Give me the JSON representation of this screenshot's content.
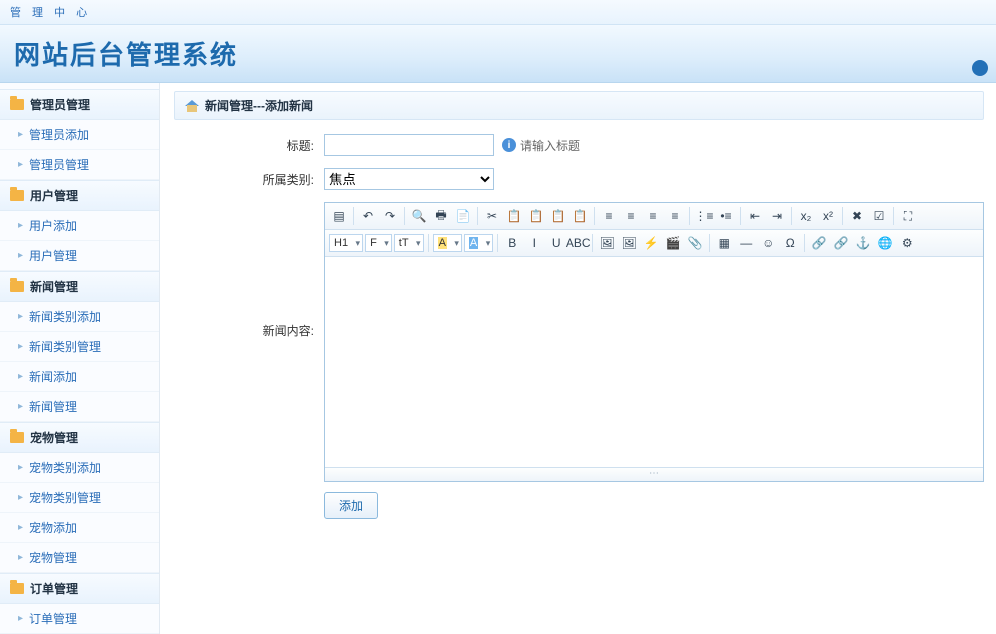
{
  "header": {
    "top_label": "管 理 中 心",
    "title": "网站后台管理系统"
  },
  "sidebar": {
    "groups": [
      {
        "label": "管理员管理",
        "items": [
          "管理员添加",
          "管理员管理"
        ]
      },
      {
        "label": "用户管理",
        "items": [
          "用户添加",
          "用户管理"
        ]
      },
      {
        "label": "新闻管理",
        "items": [
          "新闻类别添加",
          "新闻类别管理",
          "新闻添加",
          "新闻管理"
        ]
      },
      {
        "label": "宠物管理",
        "items": [
          "宠物类别添加",
          "宠物类别管理",
          "宠物添加",
          "宠物管理"
        ]
      },
      {
        "label": "订单管理",
        "items": [
          "订单管理"
        ]
      }
    ]
  },
  "breadcrumb": "新闻管理---添加新闻",
  "form": {
    "title_label": "标题:",
    "title_hint": "请输入标题",
    "category_label": "所属类别:",
    "category_value": "焦点",
    "content_label": "新闻内容:",
    "submit_label": "添加"
  },
  "editor": {
    "row1": [
      {
        "t": "btn",
        "n": "source",
        "g": "▤"
      },
      {
        "t": "sep"
      },
      {
        "t": "btn",
        "n": "undo",
        "g": "↶"
      },
      {
        "t": "btn",
        "n": "redo",
        "g": "↷"
      },
      {
        "t": "sep"
      },
      {
        "t": "btn",
        "n": "preview",
        "g": "🔍"
      },
      {
        "t": "btn",
        "n": "print",
        "g": "🖶"
      },
      {
        "t": "btn",
        "n": "template",
        "g": "📄"
      },
      {
        "t": "sep"
      },
      {
        "t": "btn",
        "n": "cut",
        "g": "✂"
      },
      {
        "t": "btn",
        "n": "copy",
        "g": "📋"
      },
      {
        "t": "btn",
        "n": "paste",
        "g": "📋"
      },
      {
        "t": "btn",
        "n": "paste-text",
        "g": "📋"
      },
      {
        "t": "btn",
        "n": "paste-word",
        "g": "📋"
      },
      {
        "t": "sep"
      },
      {
        "t": "btn",
        "n": "align-left",
        "g": "≡"
      },
      {
        "t": "btn",
        "n": "align-center",
        "g": "≡"
      },
      {
        "t": "btn",
        "n": "align-right",
        "g": "≡"
      },
      {
        "t": "btn",
        "n": "align-justify",
        "g": "≡"
      },
      {
        "t": "sep"
      },
      {
        "t": "btn",
        "n": "list-ol",
        "g": "⋮≡"
      },
      {
        "t": "btn",
        "n": "list-ul",
        "g": "•≡"
      },
      {
        "t": "sep"
      },
      {
        "t": "btn",
        "n": "outdent",
        "g": "⇤"
      },
      {
        "t": "btn",
        "n": "indent",
        "g": "⇥"
      },
      {
        "t": "sep"
      },
      {
        "t": "btn",
        "n": "subscript",
        "g": "x₂"
      },
      {
        "t": "btn",
        "n": "superscript",
        "g": "x²"
      },
      {
        "t": "sep"
      },
      {
        "t": "btn",
        "n": "clear-format",
        "g": "✖"
      },
      {
        "t": "btn",
        "n": "select-all",
        "g": "☑"
      },
      {
        "t": "sep"
      },
      {
        "t": "btn",
        "n": "fullscreen",
        "g": "⛶"
      }
    ],
    "row2": [
      {
        "t": "sel",
        "n": "heading",
        "g": "H1"
      },
      {
        "t": "sel",
        "n": "font",
        "g": "F"
      },
      {
        "t": "sel",
        "n": "size",
        "g": "tT"
      },
      {
        "t": "sep"
      },
      {
        "t": "sel",
        "n": "forecolor",
        "g": "A",
        "cls": "hl-y"
      },
      {
        "t": "sel",
        "n": "backcolor",
        "g": "A",
        "cls": "hl-b"
      },
      {
        "t": "sep"
      },
      {
        "t": "btn",
        "n": "bold",
        "g": "B"
      },
      {
        "t": "btn",
        "n": "italic",
        "g": "I"
      },
      {
        "t": "btn",
        "n": "underline",
        "g": "U"
      },
      {
        "t": "btn",
        "n": "strike",
        "g": "ABC"
      },
      {
        "t": "sep"
      },
      {
        "t": "btn",
        "n": "image",
        "g": "🖼"
      },
      {
        "t": "btn",
        "n": "multi-image",
        "g": "🖼"
      },
      {
        "t": "btn",
        "n": "flash",
        "g": "⚡"
      },
      {
        "t": "btn",
        "n": "media",
        "g": "🎬"
      },
      {
        "t": "btn",
        "n": "file",
        "g": "📎"
      },
      {
        "t": "sep"
      },
      {
        "t": "btn",
        "n": "table",
        "g": "▦"
      },
      {
        "t": "btn",
        "n": "hr",
        "g": "—"
      },
      {
        "t": "btn",
        "n": "emoticon",
        "g": "☺"
      },
      {
        "t": "btn",
        "n": "special",
        "g": "Ω"
      },
      {
        "t": "sep"
      },
      {
        "t": "btn",
        "n": "link",
        "g": "🔗"
      },
      {
        "t": "btn",
        "n": "unlink",
        "g": "🔗"
      },
      {
        "t": "btn",
        "n": "anchor",
        "g": "⚓"
      },
      {
        "t": "btn",
        "n": "map",
        "g": "🌐"
      },
      {
        "t": "btn",
        "n": "code",
        "g": "⚙"
      }
    ],
    "resize_glyph": "⋯"
  }
}
